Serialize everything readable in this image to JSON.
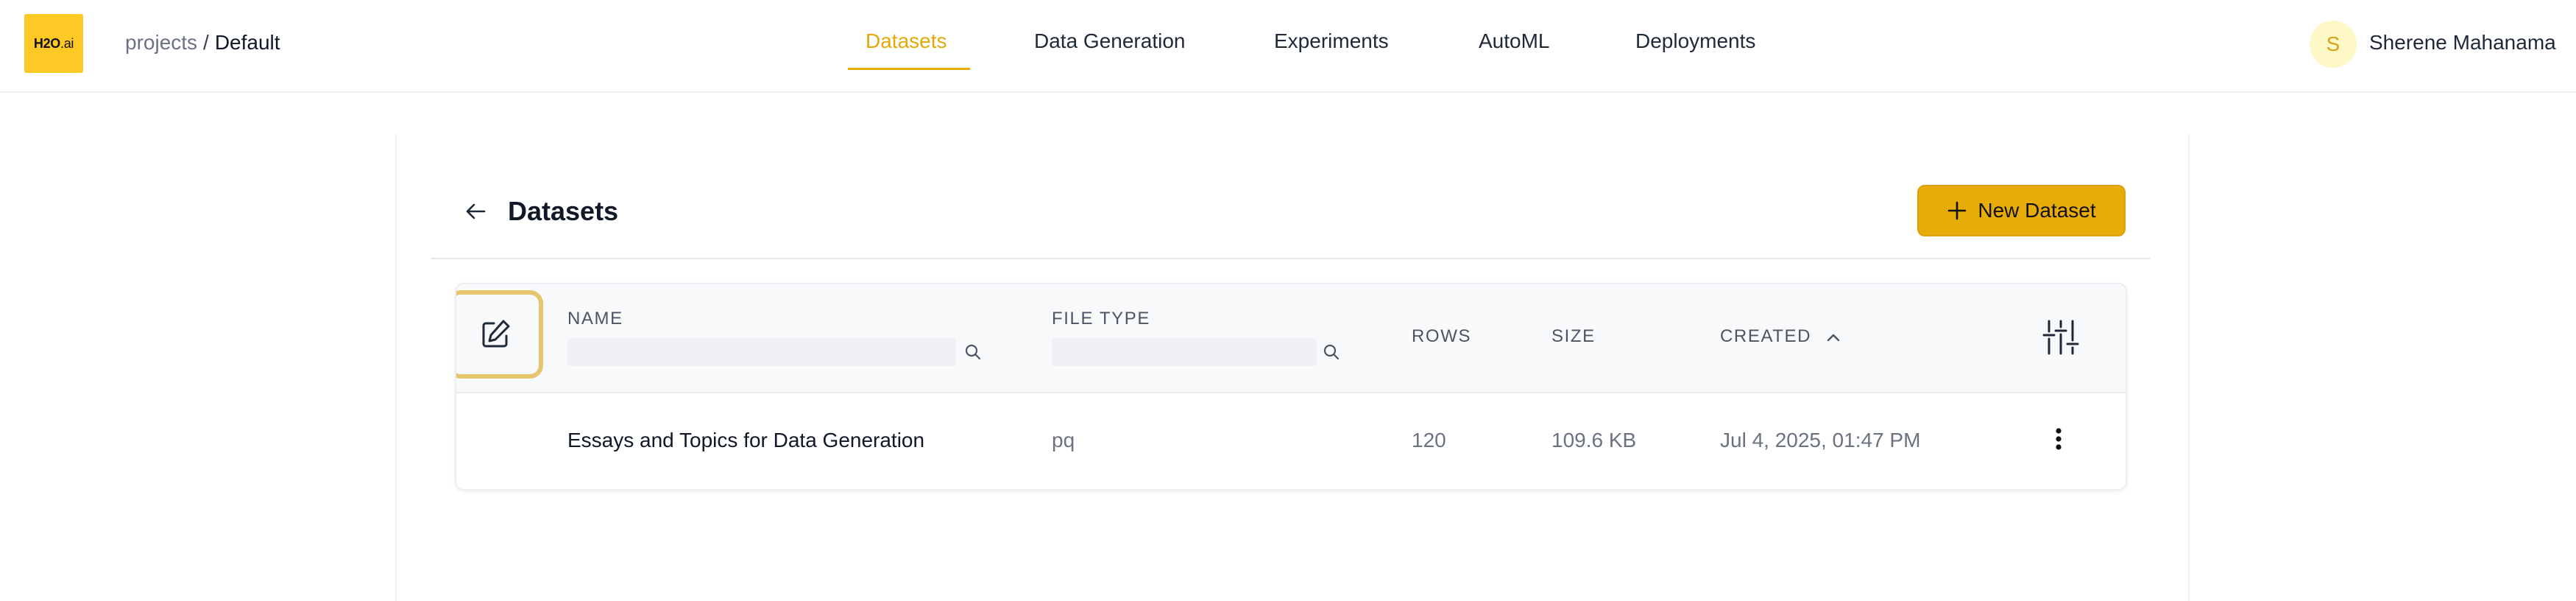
{
  "app": {
    "logo": {
      "main": "H2O",
      "suffix": ".ai"
    },
    "breadcrumb": {
      "parent": "projects",
      "separator": "/",
      "current": "Default"
    }
  },
  "nav": {
    "items": [
      {
        "label": "Datasets",
        "active": true
      },
      {
        "label": "Data Generation",
        "active": false
      },
      {
        "label": "Experiments",
        "active": false
      },
      {
        "label": "AutoML",
        "active": false
      },
      {
        "label": "Deployments",
        "active": false
      }
    ]
  },
  "user": {
    "initial": "S",
    "name": "Sherene Mahanama"
  },
  "page": {
    "title": "Datasets",
    "new_button_label": "New Dataset"
  },
  "table": {
    "columns": {
      "name": "NAME",
      "file_type": "FILE TYPE",
      "rows": "ROWS",
      "size": "SIZE",
      "created": "CREATED"
    },
    "filters": {
      "name": "",
      "file_type": ""
    },
    "sort": {
      "column": "created",
      "direction": "ascending"
    },
    "rows": [
      {
        "name": "Essays and Topics for Data Generation",
        "file_type": "pq",
        "rows": "120",
        "size": "109.6 KB",
        "created": "Jul 4, 2025, 01:47 PM"
      }
    ]
  },
  "icons": {
    "back": "arrow-left-icon",
    "new": "plus-icon",
    "edit": "edit-pencil-icon",
    "search": "search-icon",
    "sort": "chevron-up-icon",
    "settings": "sliders-icon",
    "menu": "more-vertical-icon"
  },
  "colors": {
    "accent": "#e8ac08",
    "logo_bg": "#fec925",
    "edit_highlight": "#e5c66e",
    "avatar_bg": "#fef7c6",
    "avatar_text": "#d7a21a"
  }
}
